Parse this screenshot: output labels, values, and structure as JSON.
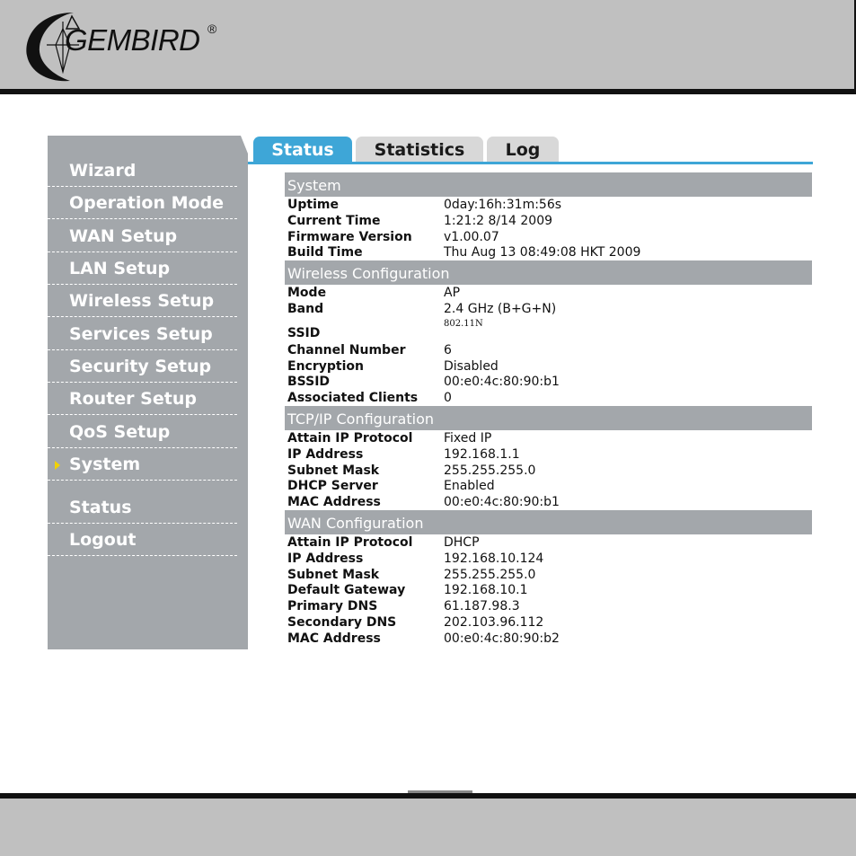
{
  "brand": {
    "logo_text": "GEMBIRD",
    "registered_mark": "®"
  },
  "sidebar": {
    "items": [
      {
        "label": "Wizard",
        "active": false
      },
      {
        "label": "Operation Mode",
        "active": false
      },
      {
        "label": "WAN Setup",
        "active": false
      },
      {
        "label": "LAN Setup",
        "active": false
      },
      {
        "label": "Wireless Setup",
        "active": false
      },
      {
        "label": "Services Setup",
        "active": false
      },
      {
        "label": "Security Setup",
        "active": false
      },
      {
        "label": "Router Setup",
        "active": false
      },
      {
        "label": "QoS Setup",
        "active": false
      },
      {
        "label": "System",
        "active": true
      },
      {
        "label": "Status",
        "active": false
      },
      {
        "label": "Logout",
        "active": false
      }
    ]
  },
  "tabs": [
    {
      "label": "Status",
      "active": true
    },
    {
      "label": "Statistics",
      "active": false
    },
    {
      "label": "Log",
      "active": false
    }
  ],
  "sections": [
    {
      "title": "System",
      "rows": [
        {
          "label": "Uptime",
          "value": "0day:16h:31m:56s"
        },
        {
          "label": "Current Time",
          "value": "1:21:2  8/14 2009"
        },
        {
          "label": "Firmware Version",
          "value": "v1.00.07"
        },
        {
          "label": "Build Time",
          "value": "Thu Aug 13 08:49:08 HKT 2009"
        }
      ]
    },
    {
      "title": "Wireless Configuration",
      "rows": [
        {
          "label": "Mode",
          "value": "AP"
        },
        {
          "label": "Band",
          "value": "2.4 GHz (B+G+N)"
        },
        {
          "label": "SSID",
          "value": "802.11N"
        },
        {
          "label": "Channel Number",
          "value": "6"
        },
        {
          "label": "Encryption",
          "value": "Disabled"
        },
        {
          "label": "BSSID",
          "value": "00:e0:4c:80:90:b1"
        },
        {
          "label": "Associated Clients",
          "value": "0"
        }
      ]
    },
    {
      "title": "TCP/IP Configuration",
      "rows": [
        {
          "label": "Attain IP Protocol",
          "value": "Fixed IP"
        },
        {
          "label": "IP Address",
          "value": "192.168.1.1"
        },
        {
          "label": "Subnet Mask",
          "value": "255.255.255.0"
        },
        {
          "label": "DHCP Server",
          "value": "Enabled"
        },
        {
          "label": "MAC Address",
          "value": "00:e0:4c:80:90:b1"
        }
      ]
    },
    {
      "title": "WAN Configuration",
      "rows": [
        {
          "label": "Attain IP Protocol",
          "value": "DHCP"
        },
        {
          "label": "IP Address",
          "value": "192.168.10.124"
        },
        {
          "label": "Subnet Mask",
          "value": "255.255.255.0"
        },
        {
          "label": "Default Gateway",
          "value": "192.168.10.1"
        },
        {
          "label": "Primary DNS",
          "value": "61.187.98.3"
        },
        {
          "label": "Secondary DNS",
          "value": "202.103.96.112"
        },
        {
          "label": "MAC Address",
          "value": "00:e0:4c:80:90:b2"
        }
      ]
    }
  ],
  "colors": {
    "tab_active": "#3ea6d7",
    "sidebar_bg": "#a3a7ab",
    "section_head_bg": "#a3a7ab",
    "active_arrow": "#f2d200"
  }
}
